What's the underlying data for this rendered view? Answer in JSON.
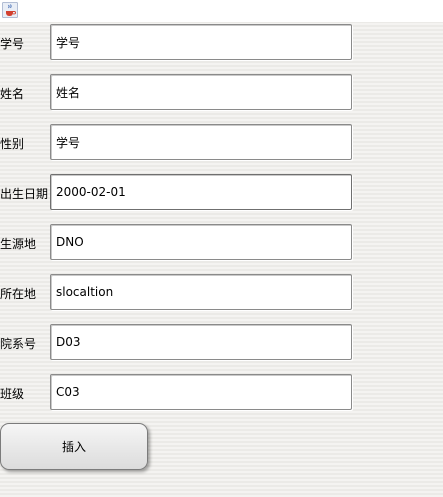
{
  "window": {
    "icon": "java-coffee-cup-icon"
  },
  "form": {
    "fields": [
      {
        "label": "学号",
        "value": "学号"
      },
      {
        "label": "姓名",
        "value": "姓名"
      },
      {
        "label": "性别",
        "value": "学号"
      },
      {
        "label": "出生日期",
        "value": "2000-02-01"
      },
      {
        "label": "生源地",
        "value": "DNO"
      },
      {
        "label": "所在地",
        "value": "slocaltion"
      },
      {
        "label": "院系号",
        "value": "D03"
      },
      {
        "label": "班级",
        "value": "C03"
      }
    ],
    "submit_label": "插入"
  }
}
